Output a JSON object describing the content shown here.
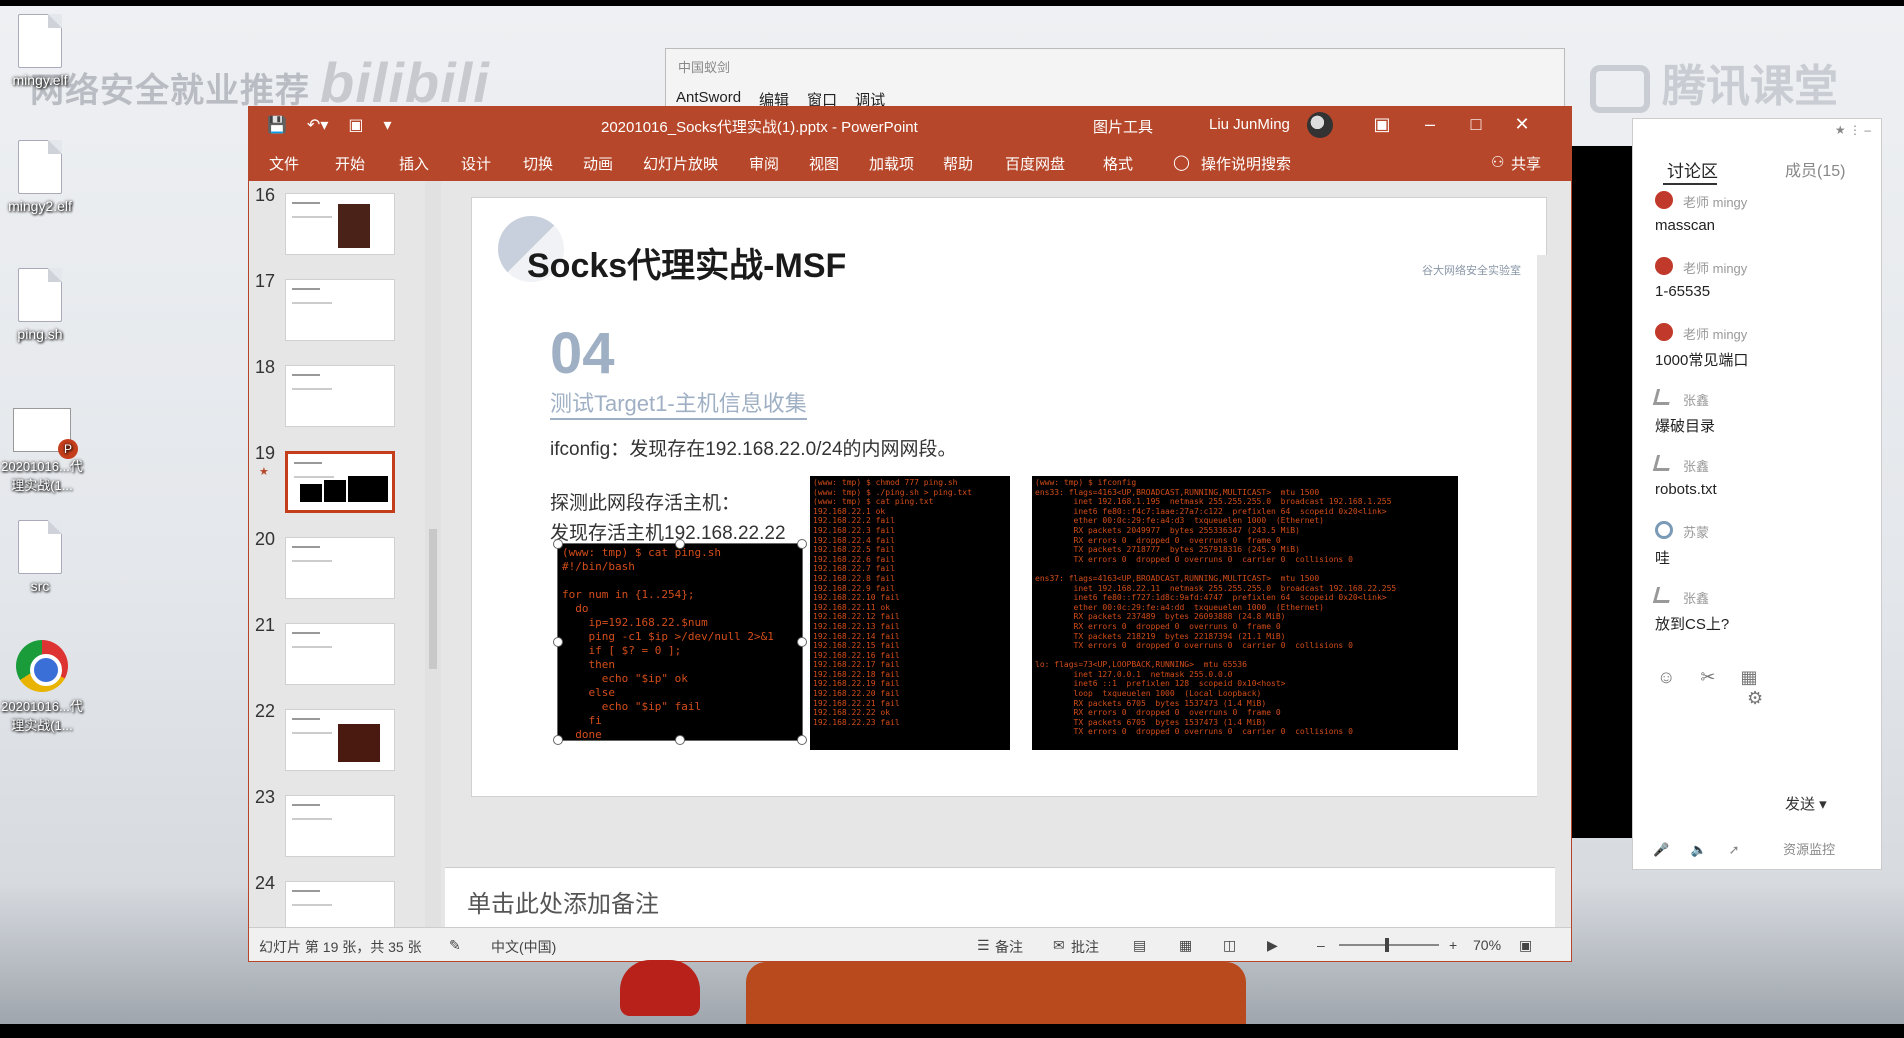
{
  "desktop": {
    "watermark": "网络安全就业推荐",
    "watermark_bili": "bilibili",
    "watermark_right": "腾讯课堂",
    "icons": [
      {
        "label": "mingy.elf"
      },
      {
        "label": "mingy2.elf"
      },
      {
        "label": "ping.sh"
      },
      {
        "label": "20201016...代理实战(1..."
      },
      {
        "label": "src"
      },
      {
        "label": "20201016...代理实战(1..."
      }
    ]
  },
  "antsword": {
    "title": "中国蚁剑",
    "menu": [
      "AntSword",
      "编辑",
      "窗口",
      "调试"
    ]
  },
  "ppt": {
    "doc_title": "20201016_Socks代理实战(1).pptx  -  PowerPoint",
    "tools_tab": "图片工具",
    "user": "Liu JunMing",
    "ribbon_tabs": [
      "文件",
      "开始",
      "插入",
      "设计",
      "切换",
      "动画",
      "幻灯片放映",
      "审阅",
      "视图",
      "加载项",
      "帮助",
      "百度网盘",
      "格式"
    ],
    "tell_me": "操作说明搜索",
    "share": "共享",
    "thumbnails": [
      "16",
      "17",
      "18",
      "19",
      "20",
      "21",
      "22",
      "23",
      "24"
    ],
    "active_slide": "19",
    "slide": {
      "title": "Socks代理实战-MSF",
      "logo": "谷大网络安全实验室",
      "section_num": "04",
      "section_title": "测试Target1-主机信息收集",
      "text1": "ifconfig：发现存在192.168.22.0/24的内网网段。",
      "text2": "探测此网段存活主机：",
      "text3": "发现存活主机192.168.22.22",
      "term1": "(www: tmp) $ cat ping.sh\n#!/bin/bash\n\nfor num in {1..254};\n  do\n    ip=192.168.22.$num\n    ping -c1 $ip >/dev/null 2>&1\n    if [ $? = 0 ];\n    then\n      echo \"$ip\" ok\n    else\n      echo \"$ip\" fail\n    fi\n  done",
      "term2": "(www: tmp) $ chmod 777 ping.sh\n(www: tmp) $ ./ping.sh > ping.txt\n(www: tmp) $ cat ping.txt\n192.168.22.1 ok\n192.168.22.2 fail\n192.168.22.3 fail\n192.168.22.4 fail\n192.168.22.5 fail\n192.168.22.6 fail\n192.168.22.7 fail\n192.168.22.8 fail\n192.168.22.9 fail\n192.168.22.10 fail\n192.168.22.11 ok\n192.168.22.12 fail\n192.168.22.13 fail\n192.168.22.14 fail\n192.168.22.15 fail\n192.168.22.16 fail\n192.168.22.17 fail\n192.168.22.18 fail\n192.168.22.19 fail\n192.168.22.20 fail\n192.168.22.21 fail\n192.168.22.22 ok\n192.168.22.23 fail",
      "term3": "(www: tmp) $ ifconfig\nens33: flags=4163<UP,BROADCAST,RUNNING,MULTICAST>  mtu 1500\n        inet 192.168.1.195  netmask 255.255.255.0  broadcast 192.168.1.255\n        inet6 fe80::f4c7:1aae:27a7:c122  prefixlen 64  scopeid 0x20<link>\n        ether 00:0c:29:fe:a4:d3  txqueuelen 1000  (Ethernet)\n        RX packets 2049977  bytes 255336347 (243.5 MiB)\n        RX errors 0  dropped 0  overruns 0  frame 0\n        TX packets 2718777  bytes 257918316 (245.9 MiB)\n        TX errors 0  dropped 0 overruns 0  carrier 0  collisions 0\n\nens37: flags=4163<UP,BROADCAST,RUNNING,MULTICAST>  mtu 1500\n        inet 192.168.22.11  netmask 255.255.255.0  broadcast 192.168.22.255\n        inet6 fe80::f727:1d8c:9afd:4747  prefixlen 64  scopeid 0x20<link>\n        ether 00:0c:29:fe:a4:dd  txqueuelen 1000  (Ethernet)\n        RX packets 237489  bytes 26093888 (24.8 MiB)\n        RX errors 0  dropped 0  overruns 0  frame 0\n        TX packets 218219  bytes 22187394 (21.1 MiB)\n        TX errors 0  dropped 0 overruns 0  carrier 0  collisions 0\n\nlo: flags=73<UP,LOOPBACK,RUNNING>  mtu 65536\n        inet 127.0.0.1  netmask 255.0.0.0\n        inet6 ::1  prefixlen 128  scopeid 0x10<host>\n        loop  txqueuelen 1000  (Local Loopback)\n        RX packets 6705  bytes 1537473 (1.4 MiB)\n        RX errors 0  dropped 0  overruns 0  frame 0\n        TX packets 6705  bytes 1537473 (1.4 MiB)\n        TX errors 0  dropped 0 overruns 0  carrier 0  collisions 0"
    },
    "notes_placeholder": "单击此处添加备注",
    "status": {
      "slide_info": "幻灯片 第 19 张，共 35 张",
      "language": "中文(中国)",
      "notes": "备注",
      "comments": "批注",
      "zoom": "70%"
    }
  },
  "chat": {
    "tab_discussion": "讨论区",
    "tab_members": "成员(15)",
    "messages": [
      {
        "author": "老师 mingy",
        "text": "masscan",
        "kind": "teacher"
      },
      {
        "author": "老师 mingy",
        "text": "1-65535",
        "kind": "teacher"
      },
      {
        "author": "老师 mingy",
        "text": "1000常见端口",
        "kind": "teacher"
      },
      {
        "author": "张鑫",
        "text": "爆破目录",
        "kind": "student"
      },
      {
        "author": "张鑫",
        "text": "robots.txt",
        "kind": "student"
      },
      {
        "author": "苏蒙",
        "text": "哇",
        "kind": "ring"
      },
      {
        "author": "张鑫",
        "text": "放到CS上?",
        "kind": "student"
      }
    ],
    "send": "发送",
    "resource_monitor": "资源监控"
  }
}
